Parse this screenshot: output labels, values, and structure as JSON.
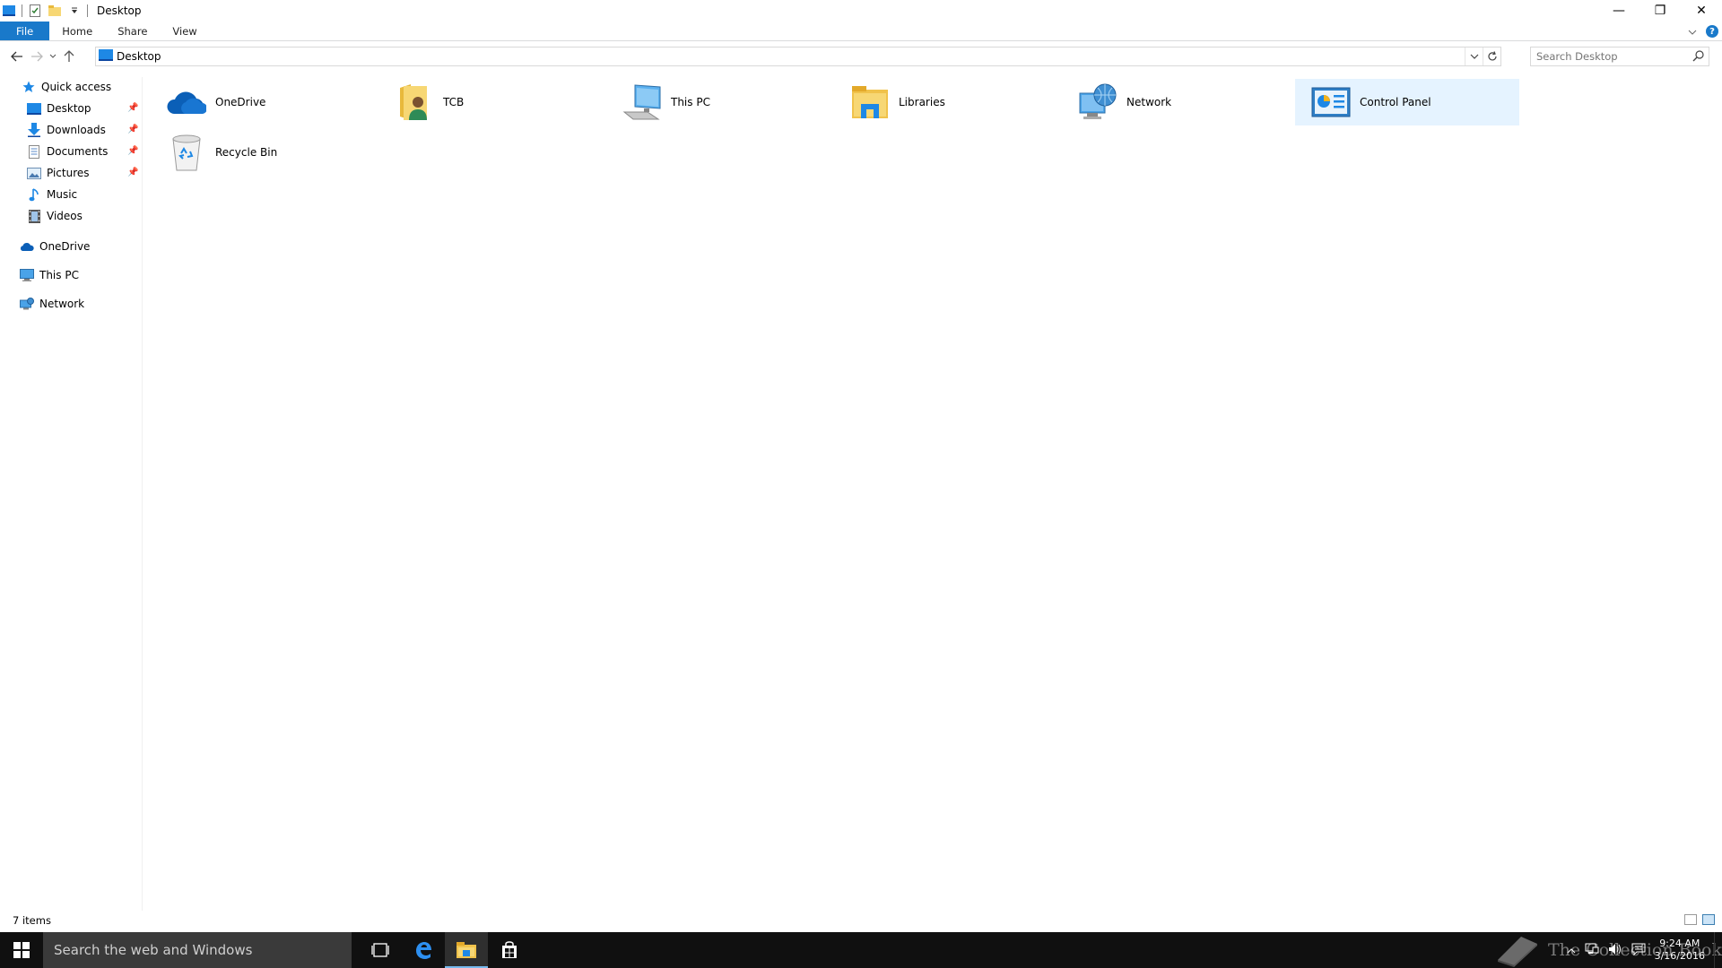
{
  "window": {
    "title": "Desktop",
    "controls": {
      "minimize": "—",
      "restore": "❐",
      "close": "✕"
    }
  },
  "ribbon": {
    "tabs": [
      "File",
      "Home",
      "Share",
      "View"
    ],
    "help": "?"
  },
  "address": {
    "path": "Desktop",
    "search_placeholder": "Search Desktop"
  },
  "nav": {
    "quick_access": "Quick access",
    "quick_items": [
      {
        "label": "Desktop",
        "pinned": true
      },
      {
        "label": "Downloads",
        "pinned": true
      },
      {
        "label": "Documents",
        "pinned": true
      },
      {
        "label": "Pictures",
        "pinned": true
      },
      {
        "label": "Music",
        "pinned": false
      },
      {
        "label": "Videos",
        "pinned": false
      }
    ],
    "onedrive": "OneDrive",
    "thispc": "This PC",
    "network": "Network"
  },
  "items": [
    {
      "label": "OneDrive",
      "icon": "onedrive-icon",
      "selected": false
    },
    {
      "label": "TCB",
      "icon": "user-folder-icon",
      "selected": false
    },
    {
      "label": "This PC",
      "icon": "computer-icon",
      "selected": false
    },
    {
      "label": "Libraries",
      "icon": "libraries-icon",
      "selected": false
    },
    {
      "label": "Network",
      "icon": "network-icon",
      "selected": false
    },
    {
      "label": "Control Panel",
      "icon": "control-panel-icon",
      "selected": true
    },
    {
      "label": "Recycle Bin",
      "icon": "recycle-bin-icon",
      "selected": false
    }
  ],
  "status": {
    "count": "7 items"
  },
  "taskbar": {
    "search": "Search the web and Windows",
    "watermark": "The Collection Book",
    "time": "9:24 AM",
    "date": "3/16/2016"
  },
  "colors": {
    "accent": "#1979ca",
    "selection": "#e5f3ff",
    "taskbar": "#101010"
  }
}
